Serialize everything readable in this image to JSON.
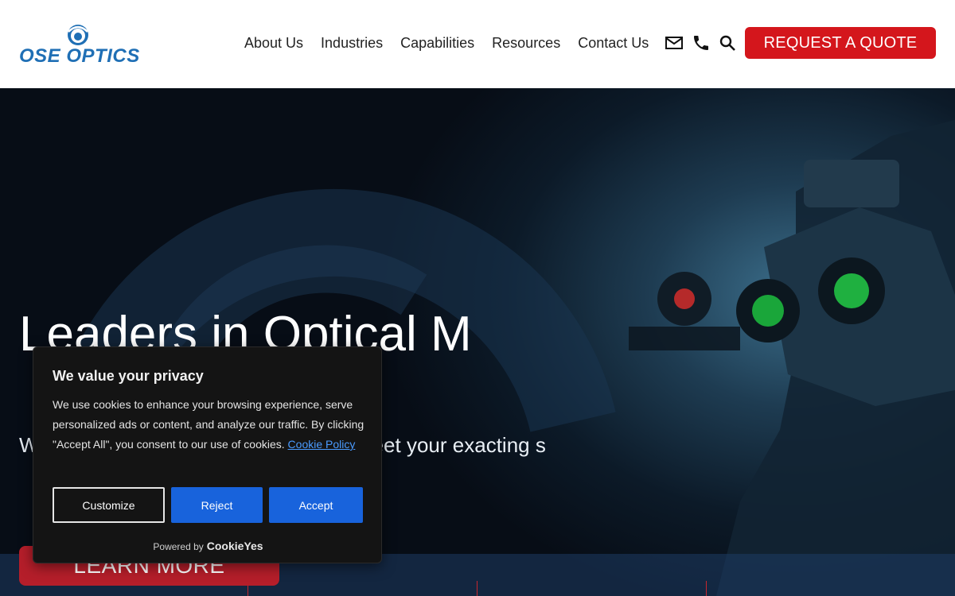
{
  "header": {
    "logo_text": "OSE OPTICS",
    "nav": [
      "About Us",
      "Industries",
      "Capabilities",
      "Resources",
      "Contact Us"
    ],
    "icons": [
      "mail-icon",
      "phone-icon",
      "search-icon"
    ],
    "quote_label": "REQUEST A QUOTE"
  },
  "hero": {
    "title": "Leaders in Optical M",
    "subtitle": "W                                              mblies with precision, d                                              ailored to meet your exacting s",
    "learn_more_label": "LEARN MORE"
  },
  "cookie": {
    "title": "We value your privacy",
    "body": "We use cookies to enhance your browsing experience, serve personalized ads or content, and analyze our traffic. By clicking \"Accept All\", you consent to our use of cookies.",
    "policy_link": "Cookie Policy",
    "customize_label": "Customize",
    "reject_label": "Reject",
    "accept_label": "Accept",
    "powered_by": "Powered by",
    "brand": "CookieYes"
  },
  "colors": {
    "brand_blue": "#1f6fb5",
    "quote_red": "#d4161c",
    "cookie_button_blue": "#1863dc"
  }
}
